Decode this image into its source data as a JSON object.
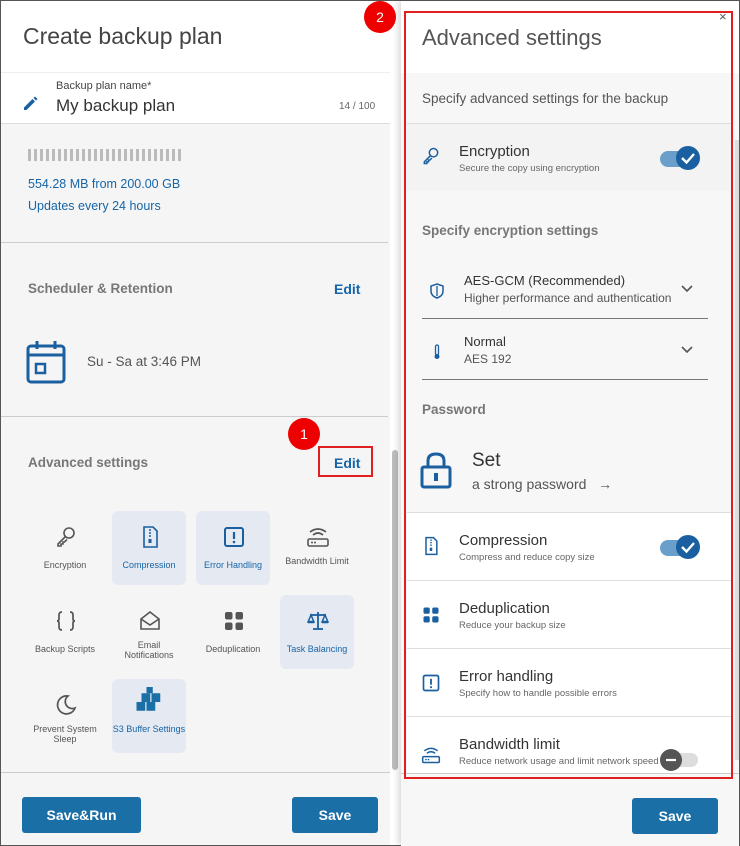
{
  "left_panel": {
    "title": "Create backup plan",
    "name_label": "Backup plan name*",
    "name_value": "My backup plan",
    "name_count": "14 / 100",
    "storage_text": "554.28 MB from 200.00 GB",
    "updates_text": "Updates every 24 hours",
    "scheduler_title": "Scheduler & Retention",
    "scheduler_edit": "Edit",
    "schedule_text": "Su - Sa at 3:46 PM",
    "advanced_title": "Advanced settings",
    "advanced_edit": "Edit",
    "tiles": [
      {
        "label": "Encryption",
        "icon": "key-icon",
        "active": false
      },
      {
        "label": "Compression",
        "icon": "compression-icon",
        "active": true
      },
      {
        "label": "Error Handling",
        "icon": "error-icon",
        "active": true
      },
      {
        "label": "Bandwidth Limit",
        "icon": "router-icon",
        "active": false
      },
      {
        "label": "Backup Scripts",
        "icon": "braces-icon",
        "active": false
      },
      {
        "label": "Email Notifications",
        "icon": "mail-icon",
        "active": false
      },
      {
        "label": "Deduplication",
        "icon": "grid-icon",
        "active": false
      },
      {
        "label": "Task Balancing",
        "icon": "scale-icon",
        "active": true
      },
      {
        "label": "Prevent System Sleep",
        "icon": "moon-icon",
        "active": false
      },
      {
        "label": "S3 Buffer Settings",
        "icon": "cubes-icon",
        "active": true
      }
    ],
    "save_run_label": "Save&Run",
    "save_label": "Save"
  },
  "badges": {
    "one": "1",
    "two": "2"
  },
  "right_panel": {
    "title": "Advanced settings",
    "close": "×",
    "subtitle": "Specify advanced settings for the backup",
    "encryption": {
      "title": "Encryption",
      "desc": "Secure the copy using encryption",
      "enabled": true
    },
    "enc_settings_title": "Specify encryption settings",
    "algorithm": {
      "main": "AES-GCM (Recommended)",
      "sub": "Higher performance and authentication"
    },
    "strength": {
      "main": "Normal",
      "sub": "AES 192"
    },
    "password_title": "Password",
    "password_set": "Set",
    "password_hint": "a strong password",
    "password_arrow": "→",
    "compression": {
      "title": "Compression",
      "desc": "Compress and reduce copy size",
      "enabled": true
    },
    "deduplication": {
      "title": "Deduplication",
      "desc": "Reduce your backup size"
    },
    "error_handling": {
      "title": "Error handling",
      "desc": "Specify how to handle possible errors"
    },
    "bandwidth": {
      "title": "Bandwidth limit",
      "desc": "Reduce network usage and limit network speed",
      "enabled": false
    },
    "save_label": "Save"
  },
  "colors": {
    "accent": "#1a6fa6",
    "link": "#1565a8",
    "highlight": "#e02020"
  }
}
